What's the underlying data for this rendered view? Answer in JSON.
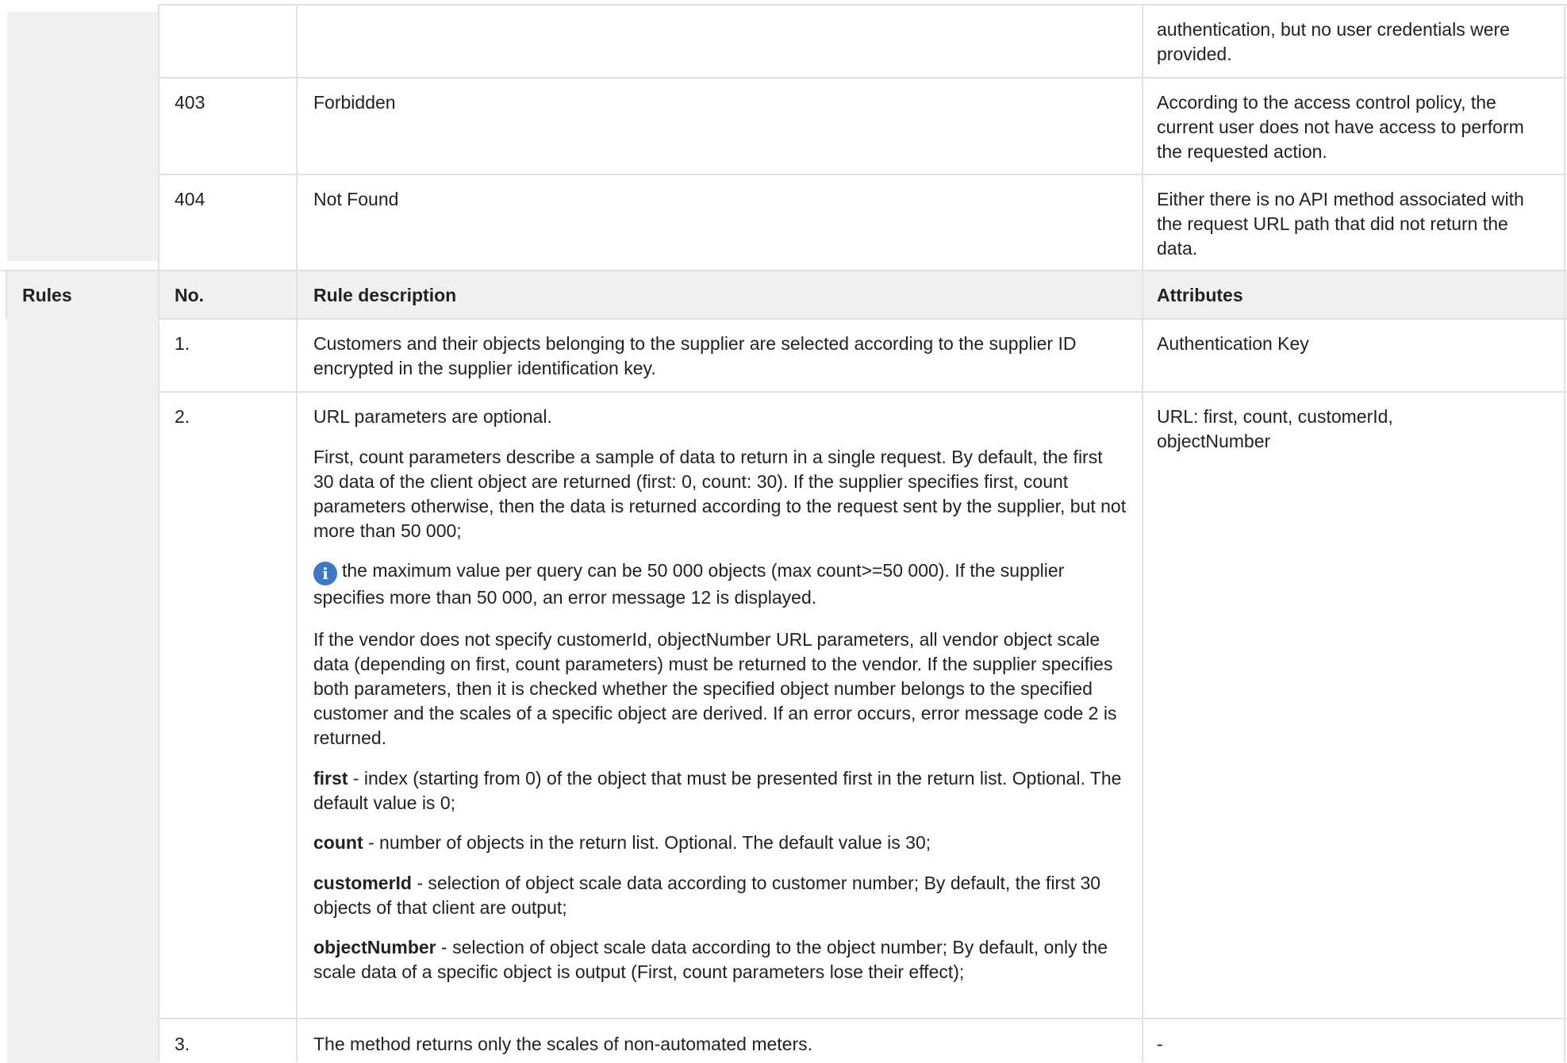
{
  "error_rows": [
    {
      "code": "",
      "name": "",
      "description": "authentication, but no user credentials were provided."
    },
    {
      "code": "403",
      "name": "Forbidden",
      "description": "According to the access control policy, the current user does not have access to perform the requested action."
    },
    {
      "code": "404",
      "name": "Not Found",
      "description": "Either there is no API method associated with the request URL path that did not return the data."
    }
  ],
  "rules": {
    "section_label": "Rules",
    "headers": {
      "no": "No.",
      "description": "Rule description",
      "attributes": "Attributes"
    },
    "rows": [
      {
        "no": "1.",
        "description": "Customers and their objects belonging to the supplier are selected according to the supplier ID encrypted in the supplier identification key.",
        "attributes": "Authentication Key"
      },
      {
        "no": "2.",
        "paragraphs": {
          "p1": "URL parameters are optional.",
          "p2": "First, count parameters describe a sample of data to return in a single request. By default, the first 30 data of the client object are returned (first: 0, count: 30). If the supplier specifies first, count parameters otherwise, then the data is returned according to the request sent by the supplier, but not more than 50 000;",
          "info_icon": "info-icon",
          "p3": "the maximum value per query can be 50 000 objects (max count>=50 000). If the supplier specifies more than 50 000, an error message 12 is displayed.",
          "p4": "If the vendor does not specify customerId, objectNumber URL parameters, all vendor object scale data (depending on first, count parameters) must be returned to the vendor. If the supplier specifies both parameters, then it is checked whether the specified object number belongs to the specified customer and the scales of a specific object are derived. If an error occurs, error message code 2 is returned.",
          "first_term": "first",
          "first_text": " - index (starting from 0) of the object that must be presented first in the return list. Optional. The default value is 0;",
          "count_term": "count",
          "count_text": " - number of objects in the return list. Optional. The default value is 30;",
          "customer_term": "customerId",
          "customer_text": " - selection of object scale data according to customer number; By default, the first 30 objects of that client are output;",
          "object_term": "objectNumber",
          "object_text": " - selection of object scale data according to the object number; By default, only the scale data of a specific object is output (First, count parameters lose their effect);"
        },
        "attributes": "URL: first, count, customerId, objectNumber"
      },
      {
        "no": "3.",
        "description": "The method returns only the scales of non-automated meters.",
        "attributes": "-"
      }
    ]
  },
  "colors": {
    "header_bg": "#f0f0f0",
    "border": "#e1e1e1",
    "text": "#222222",
    "info_icon": "#3c77c8"
  }
}
